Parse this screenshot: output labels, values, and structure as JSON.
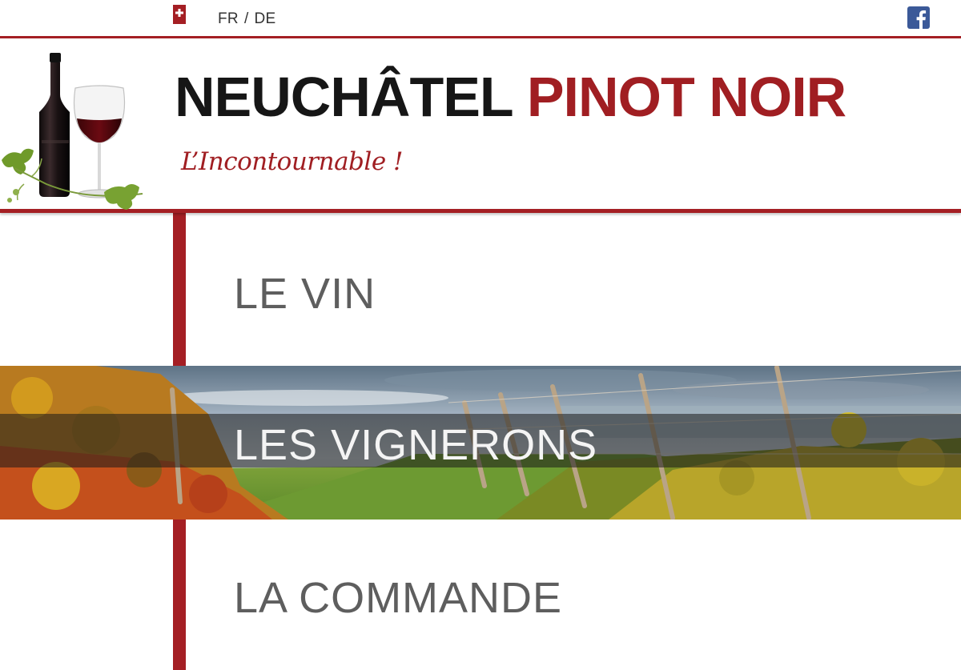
{
  "topbar": {
    "lang_fr": "FR",
    "lang_sep": "/",
    "lang_de": "DE",
    "facebook_icon": "facebook-icon",
    "swiss_icon": "swiss-cross-icon"
  },
  "header": {
    "title_part1": "NEUCHÂTEL",
    "title_part2": "PINOT NOIR",
    "tagline": "L’Incontournable !"
  },
  "menu": {
    "items": [
      {
        "label": "LE VIN"
      },
      {
        "label": "LES VIGNERONS"
      },
      {
        "label": "LA COMMANDE"
      }
    ]
  },
  "colors": {
    "accent_red": "#a41f24",
    "title_dark": "#161616",
    "menu_text": "#5e5e5e",
    "facebook_blue": "#3b5998"
  }
}
